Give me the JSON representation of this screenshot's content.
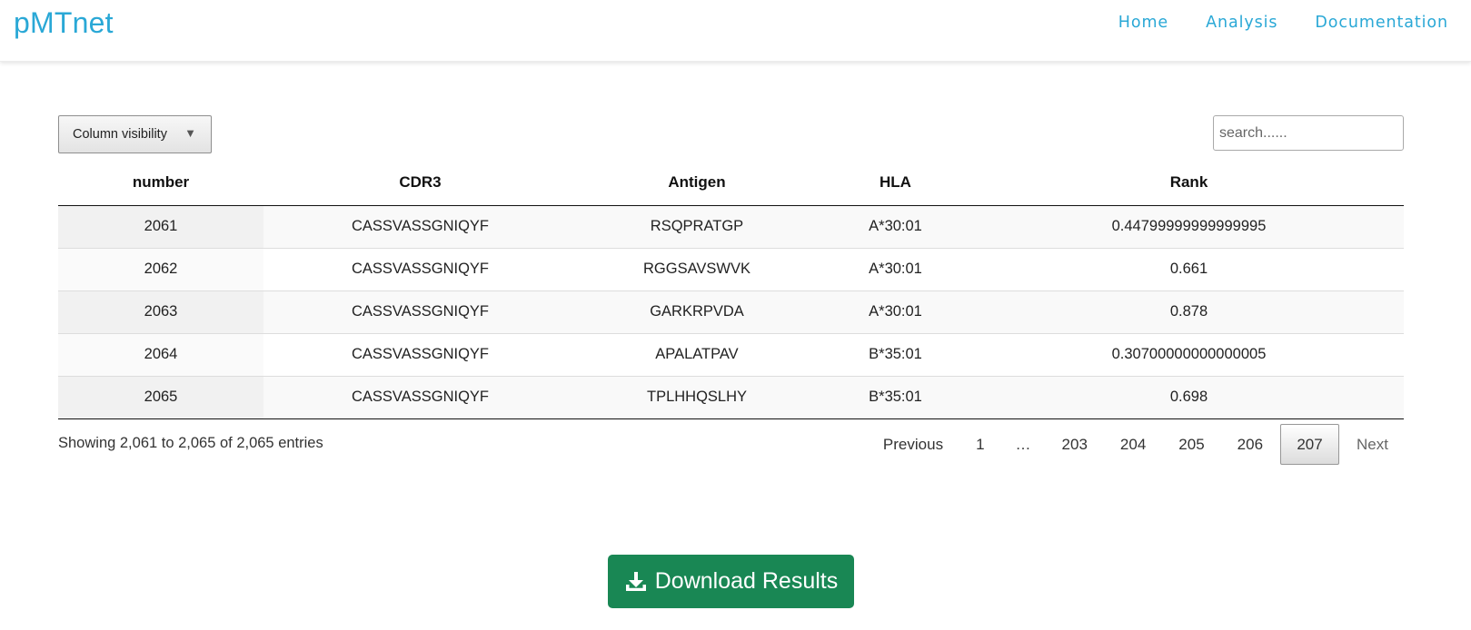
{
  "brand": "pMTnet",
  "nav": {
    "home": "Home",
    "analysis": "Analysis",
    "documentation": "Documentation"
  },
  "controls": {
    "column_visibility": "Column visibility",
    "search_placeholder": "search......"
  },
  "table": {
    "headers": {
      "number": "number",
      "cdr3": "CDR3",
      "antigen": "Antigen",
      "hla": "HLA",
      "rank": "Rank"
    },
    "rows": [
      {
        "number": "2061",
        "cdr3": "CASSVASSGNIQYF",
        "antigen": "RSQPRATGP",
        "hla": "A*30:01",
        "rank": "0.44799999999999995"
      },
      {
        "number": "2062",
        "cdr3": "CASSVASSGNIQYF",
        "antigen": "RGGSAVSWVK",
        "hla": "A*30:01",
        "rank": "0.661"
      },
      {
        "number": "2063",
        "cdr3": "CASSVASSGNIQYF",
        "antigen": "GARKRPVDA",
        "hla": "A*30:01",
        "rank": "0.878"
      },
      {
        "number": "2064",
        "cdr3": "CASSVASSGNIQYF",
        "antigen": "APALATPAV",
        "hla": "B*35:01",
        "rank": "0.30700000000000005"
      },
      {
        "number": "2065",
        "cdr3": "CASSVASSGNIQYF",
        "antigen": "TPLHHQSLHY",
        "hla": "B*35:01",
        "rank": "0.698"
      }
    ]
  },
  "info": "Showing 2,061 to 2,065 of 2,065 entries",
  "pagination": {
    "previous": "Previous",
    "pages": [
      "1",
      "…",
      "203",
      "204",
      "205",
      "206",
      "207"
    ],
    "current": "207",
    "next": "Next"
  },
  "download": {
    "label": "Download Results",
    "icon": "download-icon"
  },
  "colors": {
    "brand": "#2aa8d6",
    "download_button": "#198754"
  }
}
